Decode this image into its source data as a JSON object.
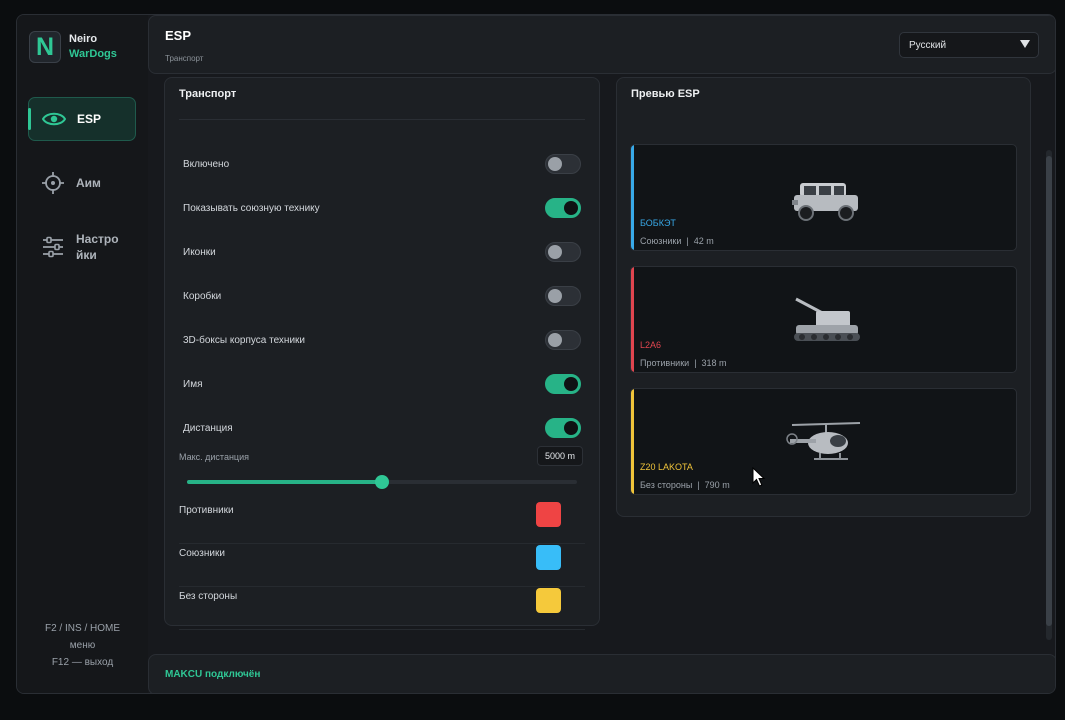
{
  "brand": {
    "logo_letter": "N",
    "name": "Neiro",
    "sub": "WarDogs",
    "accent": "#2fc795"
  },
  "sidebar": {
    "items": [
      {
        "label": "ESP",
        "icon": "eye-icon",
        "active": true
      },
      {
        "label": "Аим",
        "icon": "crosshair-icon",
        "active": false
      },
      {
        "label": "Настро\nйки",
        "icon": "sliders-icon",
        "active": false
      }
    ],
    "hotkeys": {
      "line1": "F2 / INS / HOME",
      "line2": "меню",
      "line3": "F12 — выход"
    }
  },
  "header": {
    "title": "ESP",
    "subtitle": "Транспорт",
    "language": "Русский"
  },
  "settings": {
    "title": "Транспорт",
    "toggles": [
      {
        "label": "Включено",
        "on": false
      },
      {
        "label": "Показывать союзную технику",
        "on": true
      },
      {
        "label": "Иконки",
        "on": false
      },
      {
        "label": "Коробки",
        "on": false
      },
      {
        "label": "3D-боксы корпуса техники",
        "on": false
      },
      {
        "label": "Имя",
        "on": true
      },
      {
        "label": "Дистанция",
        "on": true
      }
    ],
    "max_distance": {
      "label": "Макс. дистанция",
      "value_text": "5000 m",
      "fraction": 0.5
    },
    "colors": [
      {
        "label": "Противники",
        "color": "#ef4444"
      },
      {
        "label": "Союзники",
        "color": "#38bdf8"
      },
      {
        "label": "Без стороны",
        "color": "#f5c93b"
      }
    ]
  },
  "preview": {
    "title": "Превью ESP",
    "cards": [
      {
        "name": "БОБКЭТ",
        "side": "Союзники",
        "distance": "42 m",
        "color": "#38a9e8",
        "vehicle_icon": "jeep-icon"
      },
      {
        "name": "L2A6",
        "side": "Противники",
        "distance": "318 m",
        "color": "#e0454f",
        "vehicle_icon": "artillery-icon"
      },
      {
        "name": "Z20 LAKOTA",
        "side": "Без стороны",
        "distance": "790 m",
        "color": "#f0c43a",
        "vehicle_icon": "helicopter-icon"
      }
    ]
  },
  "footer": {
    "status": "MAKCU  подключён"
  }
}
